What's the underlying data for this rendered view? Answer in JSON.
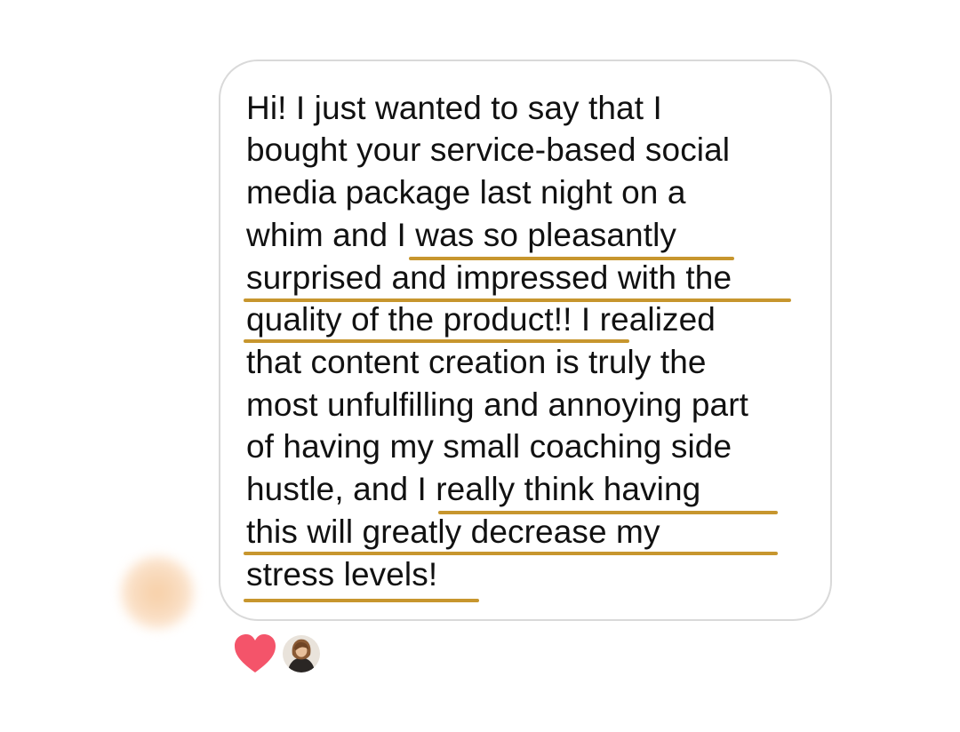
{
  "conversation": {
    "sender": {
      "avatar": "blurred-avatar"
    },
    "message": {
      "lines": [
        "Hi! I just wanted to say that I",
        "bought your service-based social",
        "media package last night on a",
        "whim and I was so pleasantly",
        "surprised and impressed with the",
        "quality of the product!! I realized",
        "that content creation is truly the",
        "most unfulfilling and annoying part",
        "of having my small coaching side",
        "hustle, and I really think having",
        "this will greatly decrease my",
        "stress levels!"
      ],
      "highlight_color": "#c7962e"
    },
    "reactions": [
      {
        "icon": "heart-icon",
        "color": "#f4546a"
      },
      {
        "icon": "reactor-avatar"
      }
    ]
  }
}
